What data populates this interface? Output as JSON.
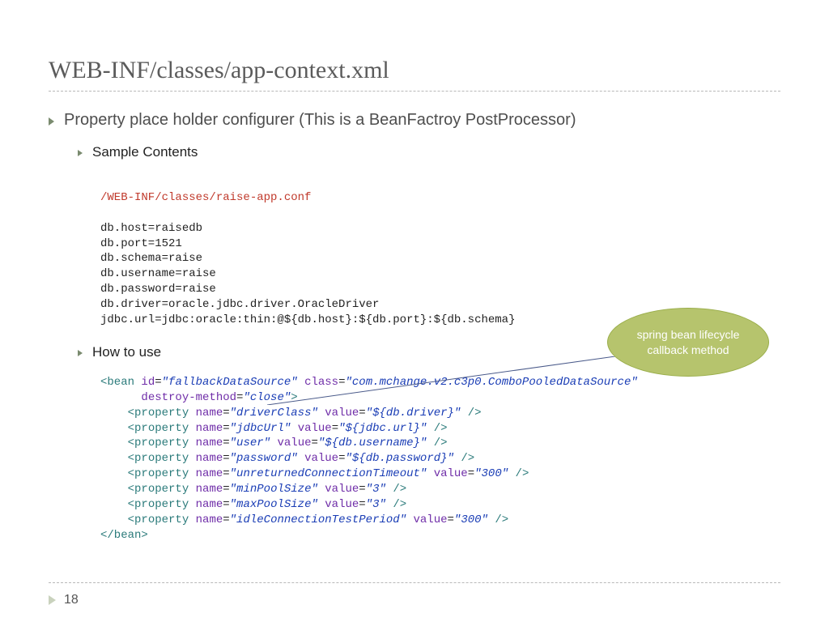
{
  "title": "WEB-INF/classes/app-context.xml",
  "bullet_main": "Property place holder configurer (This is a BeanFactroy PostProcessor)",
  "bullet_sample": "Sample Contents",
  "bullet_howto": "How to use",
  "conf_path": "/WEB-INF/classes/raise-app.conf",
  "conf_lines": [
    "db.host=raisedb",
    "db.port=1521",
    "db.schema=raise",
    "db.username=raise",
    "db.password=raise",
    "db.driver=oracle.jdbc.driver.OracleDriver",
    "jdbc.url=jdbc:oracle:thin:@${db.host}:${db.port}:${db.schema}"
  ],
  "bean_open": {
    "tag": "bean",
    "id_attr": "id",
    "id_val": "fallbackDataSource",
    "class_attr": "class",
    "class_val": "com.mchange.v2.c3p0.ComboPooledDataSource",
    "destroy_attr": "destroy-method",
    "destroy_val": "close"
  },
  "props": [
    {
      "name": "driverClass",
      "value": "${db.driver}"
    },
    {
      "name": "jdbcUrl",
      "value": "${jdbc.url}"
    },
    {
      "name": "user",
      "value": "${db.username}"
    },
    {
      "name": "password",
      "value": "${db.password}"
    },
    {
      "name": "unreturnedConnectionTimeout",
      "value": "300"
    },
    {
      "name": "minPoolSize",
      "value": "3"
    },
    {
      "name": "maxPoolSize",
      "value": "3"
    },
    {
      "name": "idleConnectionTestPeriod",
      "value": "300"
    }
  ],
  "bean_close": "bean",
  "prop_tag": "property",
  "name_attr": "name",
  "value_attr": "value",
  "callout": "spring bean lifecycle callback method",
  "page_num": "18"
}
